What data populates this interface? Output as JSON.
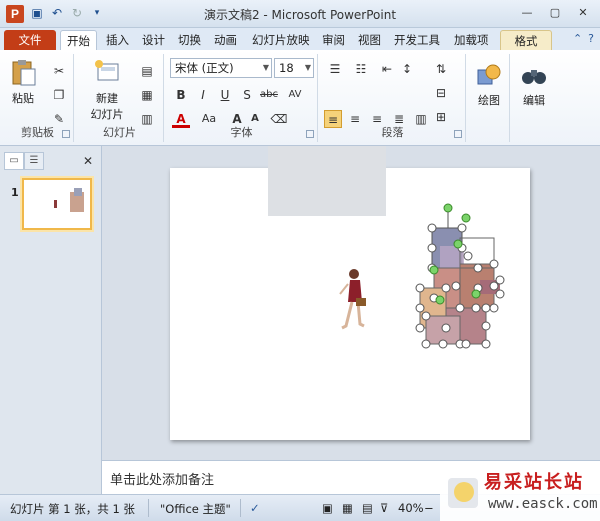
{
  "window": {
    "title": "演示文稿2 - Microsoft PowerPoint",
    "app_icon_letter": "P"
  },
  "tabs": [
    {
      "label": "文件"
    },
    {
      "label": "开始"
    },
    {
      "label": "插入"
    },
    {
      "label": "设计"
    },
    {
      "label": "切换"
    },
    {
      "label": "动画"
    },
    {
      "label": "幻灯片放映"
    },
    {
      "label": "审阅"
    },
    {
      "label": "视图"
    },
    {
      "label": "开发工具"
    },
    {
      "label": "加载项"
    },
    {
      "label": "格式"
    }
  ],
  "ribbon": {
    "clipboard": {
      "paste": "粘贴",
      "group": "剪贴板"
    },
    "slides": {
      "new_slide_line1": "新建",
      "new_slide_line2": "幻灯片",
      "group": "幻灯片"
    },
    "font": {
      "font_name": "宋体 (正文)",
      "font_size": "18",
      "group": "字体"
    },
    "paragraph": {
      "group": "段落"
    },
    "drawing": {
      "label": "绘图"
    },
    "editing": {
      "label": "编辑"
    }
  },
  "left_pane": {
    "slide_number": "1"
  },
  "notes": {
    "placeholder": "单击此处添加备注"
  },
  "status": {
    "slide_info": "幻灯片 第 1 张，共 1 张",
    "theme": "\"Office 主题\"",
    "zoom": "40%"
  },
  "watermark": {
    "title": "易采站长站",
    "url": "www.easck.com"
  },
  "colors": {
    "file_tab": "#c33d17",
    "accent": "#2a5a9a",
    "selected_thumb": "#f0b84a"
  }
}
